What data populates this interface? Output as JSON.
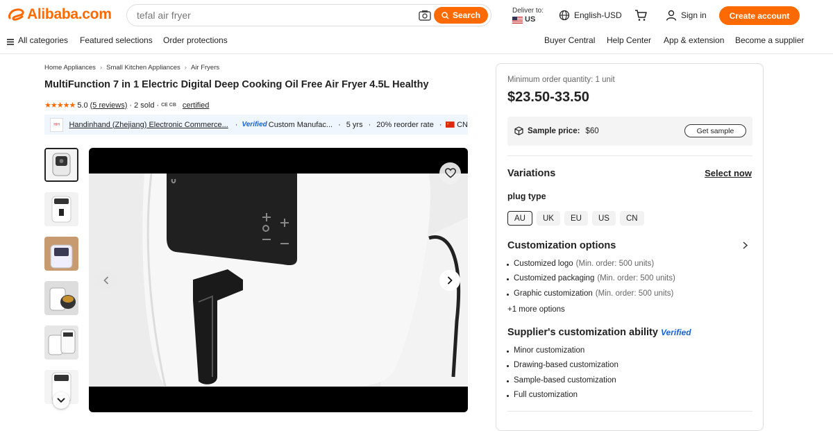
{
  "header": {
    "logo_text": "Alibaba.com",
    "search_value": "tefal air fryer",
    "search_button": "Search",
    "deliver_label": "Deliver to:",
    "deliver_country": "US",
    "language": "English-USD",
    "sign_in": "Sign in",
    "create_account": "Create account",
    "brand_color": "#ff6a00"
  },
  "nav": {
    "left": [
      "All categories",
      "Featured selections",
      "Order protections"
    ],
    "right": [
      "Buyer Central",
      "Help Center",
      "App & extension",
      "Become a supplier"
    ]
  },
  "breadcrumb": [
    "Home Appliances",
    "Small Kitchen Appliances",
    "Air Fryers"
  ],
  "product": {
    "title": "MultiFunction 7 in 1 Electric Digital Deep Cooking Oil Free Air Fryer 4.5L Healthy",
    "rating": "5.0",
    "reviews": "(5 reviews)",
    "sold": "2 sold",
    "certs": "CE CB",
    "certified": "certified"
  },
  "supplier": {
    "name": "Handinhand (Zhejiang) Electronic Commerce...",
    "verified": "Verified",
    "type": "Custom Manufac...",
    "years": "5 yrs",
    "reorder": "20% reorder rate",
    "country": "CN"
  },
  "panel": {
    "moq": "Minimum order quantity: 1 unit",
    "price": "$23.50-33.50",
    "sample_label": "Sample price:",
    "sample_price": "$60",
    "get_sample": "Get sample",
    "variations_title": "Variations",
    "select_now": "Select now",
    "plug_title": "plug type",
    "plug_options": [
      "AU",
      "UK",
      "EU",
      "US",
      "CN"
    ],
    "plug_selected": "AU",
    "custom_title": "Customization options",
    "custom_items": [
      {
        "name": "Customized logo",
        "min": "(Min. order: 500 units)"
      },
      {
        "name": "Customized packaging",
        "min": "(Min. order: 500 units)"
      },
      {
        "name": "Graphic customization",
        "min": "(Min. order: 500 units)"
      }
    ],
    "more_options": "+1 more options",
    "ability_title": "Supplier's customization ability",
    "ability_verified": "Verified",
    "ability_items": [
      "Minor customization",
      "Drawing-based customization",
      "Sample-based customization",
      "Full customization"
    ]
  },
  "icons": {
    "logo": "alibaba-logo-icon",
    "camera": "camera-icon",
    "search": "search-icon",
    "globe": "globe-icon",
    "cart": "cart-icon",
    "user": "user-icon",
    "menu": "menu-icon",
    "heart": "heart-icon",
    "box": "box-icon"
  }
}
